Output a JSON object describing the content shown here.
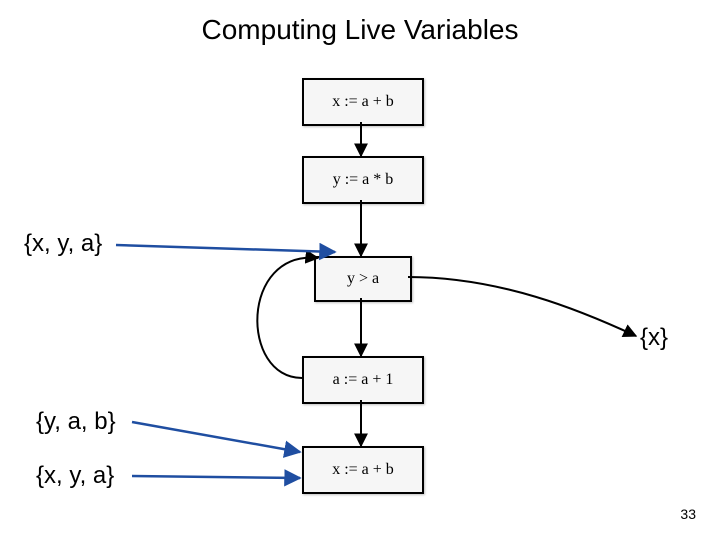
{
  "title": "Computing Live Variables",
  "nodes": {
    "n1": "x := a + b",
    "n2": "y := a * b",
    "n3": "y > a",
    "n4": "a := a + 1",
    "n5": "x := a + b"
  },
  "annotations": {
    "a1": "{x, y, a}",
    "a2": "{y, a, b}",
    "a3": "{x, y, a}",
    "a4": "{x}"
  },
  "page_number": "33",
  "colors": {
    "annotation_arrow": "#1f4ea1",
    "node_border": "#000000"
  },
  "chart_data": {
    "type": "flowchart",
    "description": "Control-flow graph illustrating live-variable analysis. Five basic blocks in a single chain with a back edge from the 4th block (a := a + 1) returning to the entry of the 3rd block (y > a). The 3rd block (y > a) also has a right-branch exit. Set annotations show live-in variables at selected program points.",
    "blocks": [
      {
        "id": "B1",
        "code": "x := a + b"
      },
      {
        "id": "B2",
        "code": "y := a * b"
      },
      {
        "id": "B3",
        "code": "y > a"
      },
      {
        "id": "B4",
        "code": "a := a + 1"
      },
      {
        "id": "B5",
        "code": "x := a + b"
      }
    ],
    "edges": [
      {
        "from": "B1",
        "to": "B2"
      },
      {
        "from": "B2",
        "to": "B3"
      },
      {
        "from": "B3",
        "to": "B4",
        "label": ""
      },
      {
        "from": "B3",
        "to": "exit-right",
        "label": ""
      },
      {
        "from": "B4",
        "to": "B5"
      },
      {
        "from": "B4",
        "to": "B3",
        "kind": "back-edge"
      }
    ],
    "live_sets": [
      {
        "at": "in(B3)",
        "set": [
          "x",
          "y",
          "a"
        ]
      },
      {
        "at": "right-branch-of-B3",
        "set": [
          "x"
        ]
      },
      {
        "at": "in(B5) / after loop",
        "set": [
          "y",
          "a",
          "b"
        ]
      },
      {
        "at": "below B5",
        "set": [
          "x",
          "y",
          "a"
        ]
      }
    ]
  }
}
